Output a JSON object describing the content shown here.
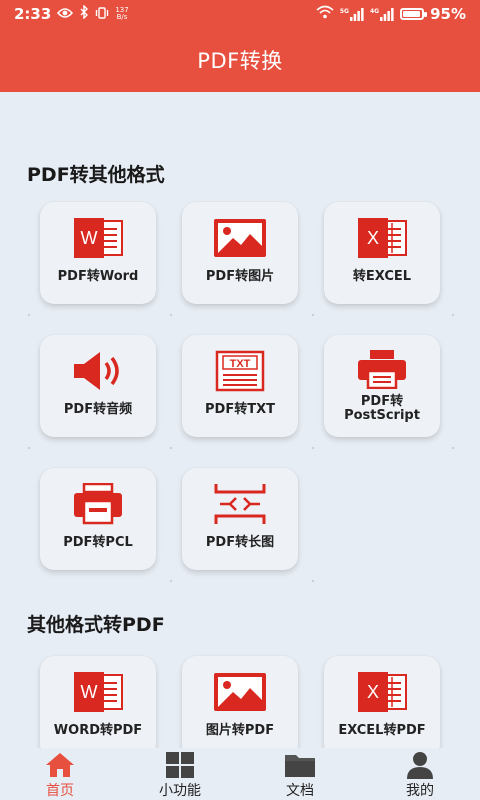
{
  "status": {
    "time": "2:33",
    "speed_top": "137",
    "speed_bottom": "B/s",
    "net1": "5G",
    "net2": "4G",
    "battery": "95%",
    "battery_level": 0.95
  },
  "header": {
    "title": "PDF转换"
  },
  "sections": [
    {
      "title": "PDF转其他格式",
      "items": [
        {
          "label": "PDF转Word",
          "icon": "word-doc-icon"
        },
        {
          "label": "PDF转图片",
          "icon": "image-icon"
        },
        {
          "label": "转EXCEL",
          "icon": "excel-icon"
        },
        {
          "label": "PDF转音频",
          "icon": "speaker-icon"
        },
        {
          "label": "PDF转TXT",
          "icon": "txt-doc-icon"
        },
        {
          "label_line1": "PDF转",
          "label_line2": "PostScript",
          "icon": "printer-icon"
        },
        {
          "label": "PDF转PCL",
          "icon": "printer-icon"
        },
        {
          "label": "PDF转长图",
          "icon": "long-image-icon"
        }
      ]
    },
    {
      "title": "其他格式转PDF",
      "items": [
        {
          "label": "WORD转PDF",
          "icon": "word-doc-icon"
        },
        {
          "label": "图片转PDF",
          "icon": "image-icon"
        },
        {
          "label": "EXCEL转PDF",
          "icon": "excel-icon"
        }
      ]
    }
  ],
  "tabs": [
    {
      "label": "首页",
      "icon": "home-icon",
      "active": true
    },
    {
      "label": "小功能",
      "icon": "grid-icon",
      "active": false
    },
    {
      "label": "文档",
      "icon": "folder-icon",
      "active": false
    },
    {
      "label": "我的",
      "icon": "user-icon",
      "active": false
    }
  ],
  "colors": {
    "accent": "#e7503f",
    "icon_red": "#d9281f",
    "background": "#e7edf4"
  }
}
